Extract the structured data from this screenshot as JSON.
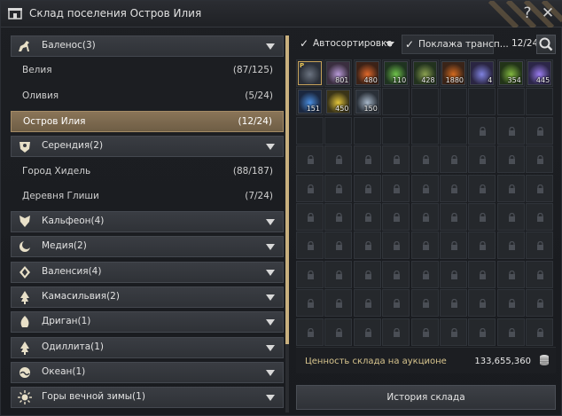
{
  "window": {
    "title": "Склад поселения Остров Илия",
    "help_label": "?",
    "close_label": "✕"
  },
  "regions": [
    {
      "name": "Баленос(3)",
      "icon": "horse-icon",
      "expanded": true,
      "towns": [
        {
          "name": "Велия",
          "count": "(87/125)"
        },
        {
          "name": "Оливия",
          "count": "(5/24)"
        },
        {
          "name": "Остров Илия",
          "count": "(12/24)",
          "selected": true
        }
      ]
    },
    {
      "name": "Серендия(2)",
      "icon": "shield-bird-icon",
      "expanded": true,
      "towns": [
        {
          "name": "Город Хидель",
          "count": "(88/187)"
        },
        {
          "name": "Деревня Глиши",
          "count": "(7/24)"
        }
      ]
    },
    {
      "name": "Кальфеон(4)",
      "icon": "wings-icon"
    },
    {
      "name": "Медия(2)",
      "icon": "crescent-icon"
    },
    {
      "name": "Валенсия(4)",
      "icon": "diamond-icon"
    },
    {
      "name": "Камасильвия(2)",
      "icon": "tree-icon"
    },
    {
      "name": "Дриган(1)",
      "icon": "flame-icon"
    },
    {
      "name": "Одиллита(1)",
      "icon": "tree-icon"
    },
    {
      "name": "Океан(1)",
      "icon": "wave-icon"
    },
    {
      "name": "Горы вечной зимы(1)",
      "icon": "sun-icon"
    }
  ],
  "toolbar": {
    "autosort_label": "Автосортировка",
    "transport_label": "Поклажа трансп...",
    "checked_mark": "✓",
    "capacity": "12/24"
  },
  "items": [
    {
      "name": "black-chest",
      "qty": "",
      "color": "#2a2f38",
      "accent": "#6b7380",
      "selected": true,
      "mark": "P"
    },
    {
      "name": "purple-flowers",
      "qty": "801",
      "color": "#3a2e3f",
      "accent": "#b89ad8"
    },
    {
      "name": "fire-stone",
      "qty": "480",
      "color": "#3c2217",
      "accent": "#e0682a"
    },
    {
      "name": "green-herb",
      "qty": "110",
      "color": "#1f3320",
      "accent": "#6ec24a"
    },
    {
      "name": "green-cone",
      "qty": "428",
      "color": "#22321e",
      "accent": "#8aa050"
    },
    {
      "name": "orange-mound",
      "qty": "1880",
      "color": "#3a2418",
      "accent": "#d46a1e"
    },
    {
      "name": "violet-crystal",
      "qty": "4",
      "color": "#2a2542",
      "accent": "#7f82e0"
    },
    {
      "name": "leaf-branch",
      "qty": "354",
      "color": "#223418",
      "accent": "#82b840"
    },
    {
      "name": "purple-ore",
      "qty": "445",
      "color": "#2c2648",
      "accent": "#9a7cf0"
    },
    {
      "name": "blue-shard",
      "qty": "151",
      "color": "#1b2840",
      "accent": "#4a8ee0"
    },
    {
      "name": "gold-dust",
      "qty": "450",
      "color": "#3a3418",
      "accent": "#e2c43a"
    },
    {
      "name": "silver-blade",
      "qty": "150",
      "color": "#2a3038",
      "accent": "#a6b6c8"
    }
  ],
  "grid_summary": {
    "open_slots": 24,
    "locked_slots": 56
  },
  "silver": {
    "label": "Ценность склада на аукционе",
    "value": "133,655,360"
  },
  "history_button": "История склада"
}
